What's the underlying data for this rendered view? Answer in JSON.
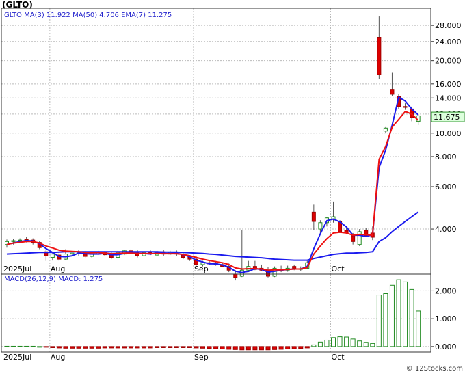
{
  "symbol": "(GLTO)",
  "copyright": "© 12Stocks.com",
  "colors": {
    "up": "#ffffff",
    "upBorder": "#228b22",
    "down": "#dd0000",
    "downBorder": "#a00000",
    "wick": "#555555",
    "ema": "#ee1111",
    "ma": "#1a1aee",
    "macd_bar": "#228b22",
    "macd_line": "#2222cc",
    "grid": "#bbbbbb",
    "label_bg": "#ddffdd"
  },
  "price_panel": {
    "legend": [
      {
        "label": "GLTO",
        "value": ""
      },
      {
        "label": "MA(3)",
        "value": "11.922"
      },
      {
        "label": "MA(50)",
        "value": "4.706"
      },
      {
        "label": "EMA(7)",
        "value": "11.275"
      }
    ],
    "y_ticks": [
      "4.000",
      "6.000",
      "8.000",
      "10.000",
      "12.000",
      "14.000",
      "16.000",
      "20.000",
      "24.000",
      "28.000"
    ],
    "last_price": "11.675"
  },
  "macd_panel": {
    "legend": [
      {
        "label": "MACD(26,12,9)",
        "value": ""
      },
      {
        "label": "MACD:",
        "value": "1.275"
      }
    ],
    "y_ticks": [
      "0.000",
      "1.000",
      "2.000"
    ]
  },
  "x_labels": [
    "2025Jul",
    "Aug",
    "Sep",
    "Oct"
  ],
  "chart_data": [
    {
      "type": "candlestick",
      "title": "(GLTO)",
      "y_scale": "log",
      "ylim": [
        2.6,
        33
      ],
      "candles": [
        {
          "o": 3.45,
          "h": 3.62,
          "l": 3.35,
          "c": 3.55
        },
        {
          "o": 3.55,
          "h": 3.65,
          "l": 3.45,
          "c": 3.58
        },
        {
          "o": 3.58,
          "h": 3.66,
          "l": 3.5,
          "c": 3.6
        },
        {
          "o": 3.62,
          "h": 3.72,
          "l": 3.52,
          "c": 3.58
        },
        {
          "o": 3.6,
          "h": 3.66,
          "l": 3.45,
          "c": 3.52
        },
        {
          "o": 3.52,
          "h": 3.58,
          "l": 3.3,
          "c": 3.35
        },
        {
          "o": 3.22,
          "h": 3.28,
          "l": 2.95,
          "c": 3.1
        },
        {
          "o": 3.05,
          "h": 3.2,
          "l": 2.96,
          "c": 3.15
        },
        {
          "o": 3.12,
          "h": 3.18,
          "l": 2.95,
          "c": 3.0
        },
        {
          "o": 3.0,
          "h": 3.3,
          "l": 2.98,
          "c": 3.15
        },
        {
          "o": 3.15,
          "h": 3.25,
          "l": 3.05,
          "c": 3.18
        },
        {
          "o": 3.2,
          "h": 3.28,
          "l": 3.1,
          "c": 3.22
        },
        {
          "o": 3.22,
          "h": 3.25,
          "l": 3.03,
          "c": 3.08
        },
        {
          "o": 3.08,
          "h": 3.18,
          "l": 3.05,
          "c": 3.15
        },
        {
          "o": 3.15,
          "h": 3.25,
          "l": 3.12,
          "c": 3.22
        },
        {
          "o": 3.2,
          "h": 3.24,
          "l": 3.1,
          "c": 3.13
        },
        {
          "o": 3.15,
          "h": 3.22,
          "l": 3.0,
          "c": 3.05
        },
        {
          "o": 3.05,
          "h": 3.25,
          "l": 3.02,
          "c": 3.2
        },
        {
          "o": 3.15,
          "h": 3.28,
          "l": 3.12,
          "c": 3.25
        },
        {
          "o": 3.25,
          "h": 3.3,
          "l": 3.15,
          "c": 3.2
        },
        {
          "o": 3.2,
          "h": 3.28,
          "l": 3.05,
          "c": 3.1
        },
        {
          "o": 3.1,
          "h": 3.22,
          "l": 3.08,
          "c": 3.2
        },
        {
          "o": 3.2,
          "h": 3.26,
          "l": 3.12,
          "c": 3.15
        },
        {
          "o": 3.12,
          "h": 3.25,
          "l": 3.1,
          "c": 3.22
        },
        {
          "o": 3.22,
          "h": 3.28,
          "l": 3.1,
          "c": 3.15
        },
        {
          "o": 3.15,
          "h": 3.25,
          "l": 3.12,
          "c": 3.2
        },
        {
          "o": 3.2,
          "h": 3.26,
          "l": 3.1,
          "c": 3.15
        },
        {
          "o": 3.12,
          "h": 3.18,
          "l": 3.0,
          "c": 3.05
        },
        {
          "o": 3.06,
          "h": 3.12,
          "l": 2.95,
          "c": 3.0
        },
        {
          "o": 3.0,
          "h": 3.08,
          "l": 2.82,
          "c": 2.85
        },
        {
          "o": 2.85,
          "h": 2.95,
          "l": 2.8,
          "c": 2.9
        },
        {
          "o": 2.9,
          "h": 2.95,
          "l": 2.85,
          "c": 2.87
        },
        {
          "o": 2.88,
          "h": 2.95,
          "l": 2.82,
          "c": 2.85
        },
        {
          "o": 2.85,
          "h": 2.9,
          "l": 2.78,
          "c": 2.8
        },
        {
          "o": 2.8,
          "h": 2.88,
          "l": 2.65,
          "c": 2.7
        },
        {
          "o": 2.6,
          "h": 2.7,
          "l": 2.45,
          "c": 2.52
        },
        {
          "o": 2.55,
          "h": 3.95,
          "l": 2.53,
          "c": 2.7
        },
        {
          "o": 2.7,
          "h": 2.95,
          "l": 2.65,
          "c": 2.8
        },
        {
          "o": 2.8,
          "h": 2.95,
          "l": 2.7,
          "c": 2.72
        },
        {
          "o": 2.75,
          "h": 2.85,
          "l": 2.68,
          "c": 2.7
        },
        {
          "o": 2.7,
          "h": 2.78,
          "l": 2.52,
          "c": 2.55
        },
        {
          "o": 2.55,
          "h": 2.8,
          "l": 2.53,
          "c": 2.75
        },
        {
          "o": 2.72,
          "h": 2.82,
          "l": 2.65,
          "c": 2.7
        },
        {
          "o": 2.7,
          "h": 2.82,
          "l": 2.66,
          "c": 2.75
        },
        {
          "o": 2.8,
          "h": 2.85,
          "l": 2.7,
          "c": 2.75
        },
        {
          "o": 2.72,
          "h": 2.8,
          "l": 2.68,
          "c": 2.74
        },
        {
          "o": 2.75,
          "h": 2.95,
          "l": 2.73,
          "c": 2.9
        },
        {
          "o": 4.7,
          "h": 5.05,
          "l": 3.95,
          "c": 4.3
        },
        {
          "o": 4.0,
          "h": 4.35,
          "l": 3.85,
          "c": 4.25
        },
        {
          "o": 4.25,
          "h": 4.5,
          "l": 4.1,
          "c": 4.45
        },
        {
          "o": 4.4,
          "h": 5.2,
          "l": 4.25,
          "c": 4.5
        },
        {
          "o": 4.3,
          "h": 4.35,
          "l": 3.85,
          "c": 3.9
        },
        {
          "o": 3.95,
          "h": 4.05,
          "l": 3.8,
          "c": 3.85
        },
        {
          "o": 3.75,
          "h": 3.85,
          "l": 3.45,
          "c": 3.55
        },
        {
          "o": 3.45,
          "h": 4.0,
          "l": 3.4,
          "c": 3.9
        },
        {
          "o": 3.95,
          "h": 4.05,
          "l": 3.7,
          "c": 3.75
        },
        {
          "o": 3.85,
          "h": 4.1,
          "l": 3.6,
          "c": 3.7
        },
        {
          "o": 25.0,
          "h": 30.5,
          "l": 16.8,
          "c": 17.5
        },
        {
          "o": 10.2,
          "h": 10.6,
          "l": 10.0,
          "c": 10.5
        },
        {
          "o": 15.2,
          "h": 17.8,
          "l": 14.3,
          "c": 14.5
        },
        {
          "o": 14.2,
          "h": 14.5,
          "l": 12.6,
          "c": 12.9
        },
        {
          "o": 12.9,
          "h": 13.3,
          "l": 12.5,
          "c": 12.8
        },
        {
          "o": 12.6,
          "h": 12.9,
          "l": 11.2,
          "c": 11.6
        },
        {
          "o": 11.2,
          "h": 12.0,
          "l": 10.8,
          "c": 11.8
        }
      ],
      "ema": [
        3.45,
        3.5,
        3.52,
        3.55,
        3.55,
        3.5,
        3.4,
        3.34,
        3.27,
        3.24,
        3.23,
        3.22,
        3.2,
        3.19,
        3.2,
        3.18,
        3.16,
        3.17,
        3.18,
        3.18,
        3.17,
        3.17,
        3.16,
        3.17,
        3.16,
        3.16,
        3.16,
        3.14,
        3.1,
        3.05,
        3.0,
        2.96,
        2.93,
        2.9,
        2.85,
        2.76,
        2.73,
        2.74,
        2.74,
        2.73,
        2.7,
        2.71,
        2.71,
        2.72,
        2.73,
        2.73,
        2.77,
        3.15,
        3.4,
        3.65,
        3.85,
        3.88,
        3.85,
        3.77,
        3.8,
        3.79,
        3.77,
        7.8,
        8.8,
        10.6,
        11.4,
        12.3,
        12.0,
        11.3
      ],
      "ma_fast": [
        3.45,
        3.5,
        3.55,
        3.58,
        3.57,
        3.48,
        3.32,
        3.2,
        3.08,
        3.07,
        3.1,
        3.18,
        3.16,
        3.15,
        3.15,
        3.17,
        3.13,
        3.13,
        3.17,
        3.22,
        3.18,
        3.17,
        3.15,
        3.19,
        3.17,
        3.17,
        3.18,
        3.13,
        3.07,
        2.97,
        2.92,
        2.87,
        2.87,
        2.84,
        2.78,
        2.67,
        2.64,
        2.67,
        2.74,
        2.72,
        2.65,
        2.67,
        2.7,
        2.72,
        2.73,
        2.73,
        2.8,
        3.32,
        3.82,
        4.33,
        4.4,
        4.28,
        4.08,
        3.77,
        3.77,
        3.73,
        3.78,
        7.2,
        8.5,
        10.8,
        14.1,
        13.6,
        12.6,
        11.9
      ],
      "ma_slow": [
        3.15,
        3.16,
        3.17,
        3.18,
        3.19,
        3.2,
        3.2,
        3.2,
        3.21,
        3.22,
        3.22,
        3.22,
        3.22,
        3.22,
        3.22,
        3.22,
        3.22,
        3.22,
        3.22,
        3.22,
        3.22,
        3.22,
        3.22,
        3.22,
        3.21,
        3.21,
        3.21,
        3.2,
        3.19,
        3.18,
        3.17,
        3.15,
        3.14,
        3.12,
        3.1,
        3.08,
        3.07,
        3.06,
        3.05,
        3.04,
        3.02,
        3.0,
        2.99,
        2.98,
        2.97,
        2.97,
        2.97,
        3.02,
        3.06,
        3.1,
        3.14,
        3.16,
        3.18,
        3.18,
        3.19,
        3.2,
        3.22,
        3.55,
        3.68,
        3.9,
        4.1,
        4.3,
        4.5,
        4.706
      ]
    },
    {
      "type": "bar",
      "title": "MACD(26,12,9)",
      "ylim": [
        -0.2,
        2.6
      ],
      "values": [
        0.01,
        0.01,
        0.01,
        0.01,
        0.01,
        0.0,
        -0.02,
        -0.04,
        -0.05,
        -0.06,
        -0.06,
        -0.06,
        -0.06,
        -0.06,
        -0.06,
        -0.05,
        -0.05,
        -0.05,
        -0.05,
        -0.05,
        -0.05,
        -0.05,
        -0.05,
        -0.04,
        -0.04,
        -0.04,
        -0.04,
        -0.04,
        -0.04,
        -0.05,
        -0.06,
        -0.07,
        -0.08,
        -0.09,
        -0.1,
        -0.11,
        -0.12,
        -0.12,
        -0.12,
        -0.12,
        -0.12,
        -0.11,
        -0.1,
        -0.09,
        -0.08,
        -0.07,
        -0.05,
        0.06,
        0.16,
        0.23,
        0.32,
        0.35,
        0.34,
        0.27,
        0.2,
        0.15,
        0.11,
        1.85,
        1.9,
        2.2,
        2.4,
        2.32,
        2.05,
        1.275
      ]
    }
  ]
}
